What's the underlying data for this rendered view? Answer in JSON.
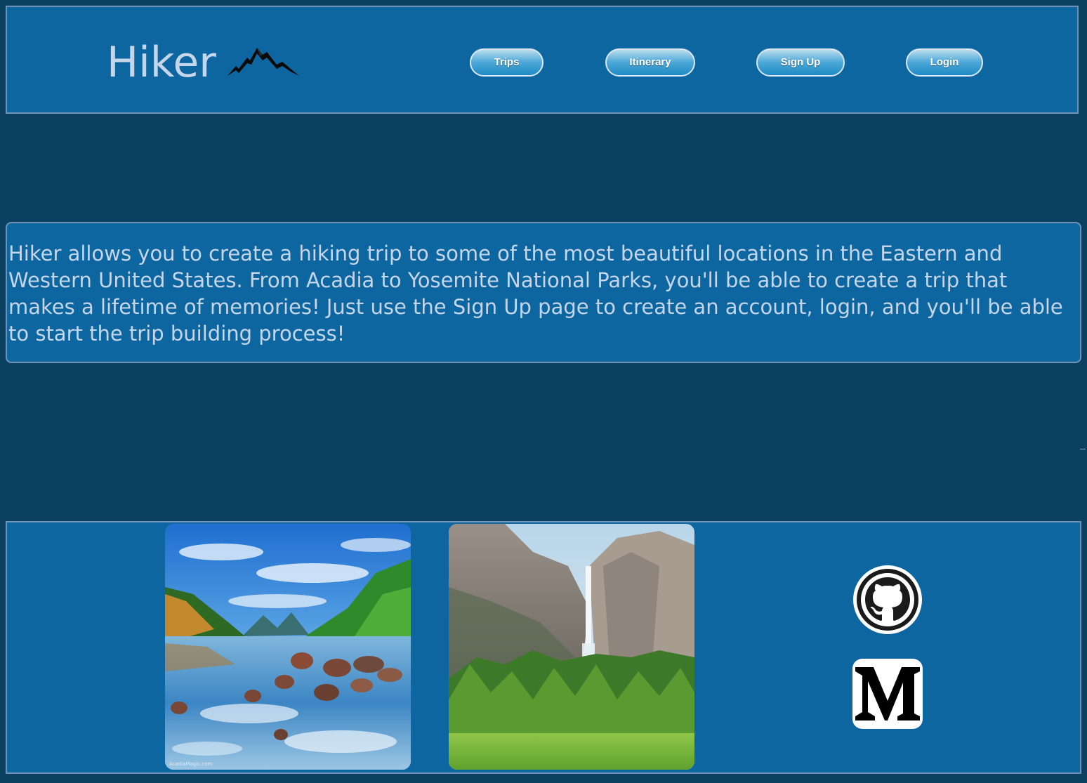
{
  "brand": {
    "title": "Hiker",
    "logo_icon": "mountain-icon"
  },
  "nav": [
    {
      "label": "Trips"
    },
    {
      "label": "Itinerary"
    },
    {
      "label": "Sign Up"
    },
    {
      "label": "Login"
    }
  ],
  "intro": {
    "text": "Hiker allows you to create a hiking trip to some of the most beautiful locations in the Eastern and Western United States. From Acadia to Yosemite National Parks, you'll be able to create a trip that makes a lifetime of memories! Just use the Sign Up page to create an account, login, and you'll be able to start the trip building process!"
  },
  "footer": {
    "photos": [
      {
        "name": "acadia-lake-photo",
        "watermark": "AcadiaMagic.com"
      },
      {
        "name": "yosemite-falls-photo"
      }
    ],
    "social": [
      {
        "icon": "github-icon"
      },
      {
        "icon": "medium-icon"
      }
    ]
  },
  "colors": {
    "page_bg": "#0c4060",
    "panel_bg": "#0d66a0",
    "border": "#6f93b8",
    "text": "#c5d6ea",
    "button_top": "#b9dcee",
    "button_bottom": "#1e8bc6"
  }
}
